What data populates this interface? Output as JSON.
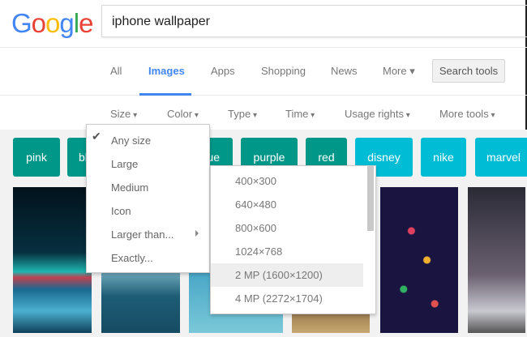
{
  "logo": "Google",
  "search": {
    "query": "iphone wallpaper"
  },
  "tabs": [
    {
      "label": "All"
    },
    {
      "label": "Images"
    },
    {
      "label": "Apps"
    },
    {
      "label": "Shopping"
    },
    {
      "label": "News"
    },
    {
      "label": "More ▾"
    }
  ],
  "search_tools": "Search tools",
  "filters": [
    "Size",
    "Color",
    "Type",
    "Time",
    "Usage rights",
    "More tools"
  ],
  "chips": [
    {
      "label": "pink",
      "color": "#009688"
    },
    {
      "label": "black",
      "color": "#009688"
    },
    {
      "label": "blue",
      "color": "#009688"
    },
    {
      "label": "purple",
      "color": "#009688"
    },
    {
      "label": "red",
      "color": "#009688"
    },
    {
      "label": "disney",
      "color": "#00bcd4"
    },
    {
      "label": "nike",
      "color": "#00bcd4"
    },
    {
      "label": "marvel",
      "color": "#00bcd4"
    }
  ],
  "size_menu": {
    "checkmark": "✔",
    "items": [
      "Any size",
      "Large",
      "Medium",
      "Icon",
      "Larger than...",
      "Exactly..."
    ],
    "selected": "Any size"
  },
  "larger_than_menu": {
    "items": [
      "400×300",
      "640×480",
      "800×600",
      "1024×768",
      "2 MP (1600×1200)",
      "4 MP (2272×1704)"
    ],
    "highlighted": "2 MP (1600×1200)"
  }
}
